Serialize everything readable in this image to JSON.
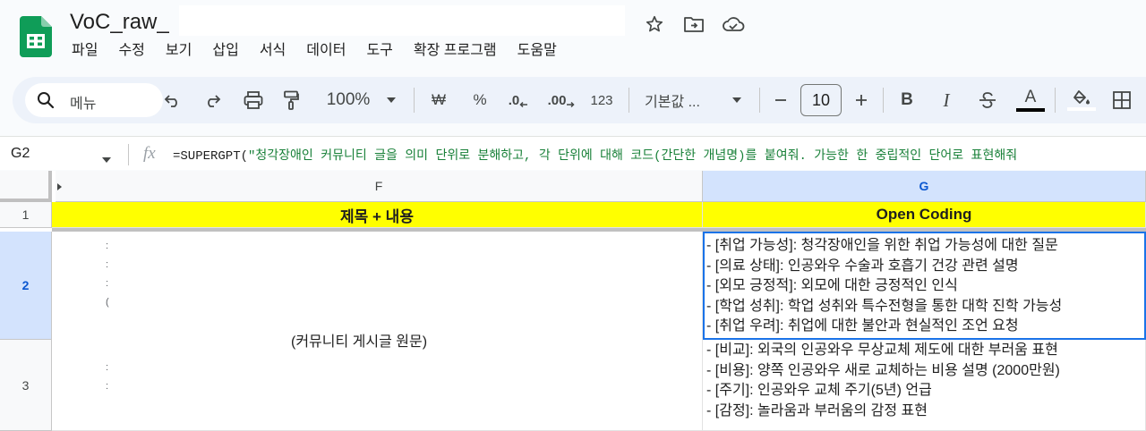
{
  "app": {
    "doc_title": "VoC_raw_",
    "brand_color": "#0f9d58"
  },
  "menu": [
    "파일",
    "수정",
    "보기",
    "삽입",
    "서식",
    "데이터",
    "도구",
    "확장 프로그램",
    "도움말"
  ],
  "toolbar": {
    "search_label": "메뉴",
    "zoom": "100%",
    "currency": "₩",
    "percent": "%",
    "dec_decrease": ".0",
    "dec_increase": ".00",
    "number_format": "123",
    "font_name": "기본값 ...",
    "font_size": "10",
    "bold": "B",
    "italic": "I",
    "text_color_letter": "A"
  },
  "formula_bar": {
    "cell_ref": "G2",
    "fx": "fx",
    "formula_prefix": "=SUPERGPT(",
    "formula_string": "\"청각장애인 커뮤니티 글을 의미 단위로 분해하고, 각 단위에 대해 코드(간단한 개념명)를 붙여줘. 가능한 한 중립적인 단어로 표현해줘"
  },
  "grid": {
    "columns": [
      {
        "id": "F",
        "selected": false
      },
      {
        "id": "G",
        "selected": true
      }
    ],
    "rows": [
      {
        "id": "1",
        "selected": false
      },
      {
        "id": "2",
        "selected": true
      },
      {
        "id": "3",
        "selected": false
      }
    ],
    "header_row": {
      "F": "제목 + 내용",
      "G": "Open Coding"
    },
    "merged_F_text": "(커뮤니티 게시글 원문)",
    "G2_lines": [
      "- [취업 가능성]: 청각장애인을 위한 취업 가능성에 대한 질문",
      "- [의료 상태]: 인공와우 수술과 호흡기 건강 관련 설명",
      "- [외모 긍정적]: 외모에 대한 긍정적인 인식",
      "- [학업 성취]: 학업 성취와 특수전형을 통한 대학 진학 가능성",
      "- [취업 우려]: 취업에 대한 불안과 현실적인 조언 요청"
    ],
    "G3_lines": [
      "- [비교]: 외국의 인공와우 무상교체 제도에 대한 부러움 표현",
      "- [비용]: 양쪽 인공와우 새로 교체하는 비용 설명 (2000만원)",
      "- [주기]: 인공와우 교체 주기(5년) 언급",
      "- [감정]: 놀라움과 부러움의 감정 표현"
    ],
    "header_fill": "#ffff00",
    "selection_color": "#1a73e8"
  }
}
